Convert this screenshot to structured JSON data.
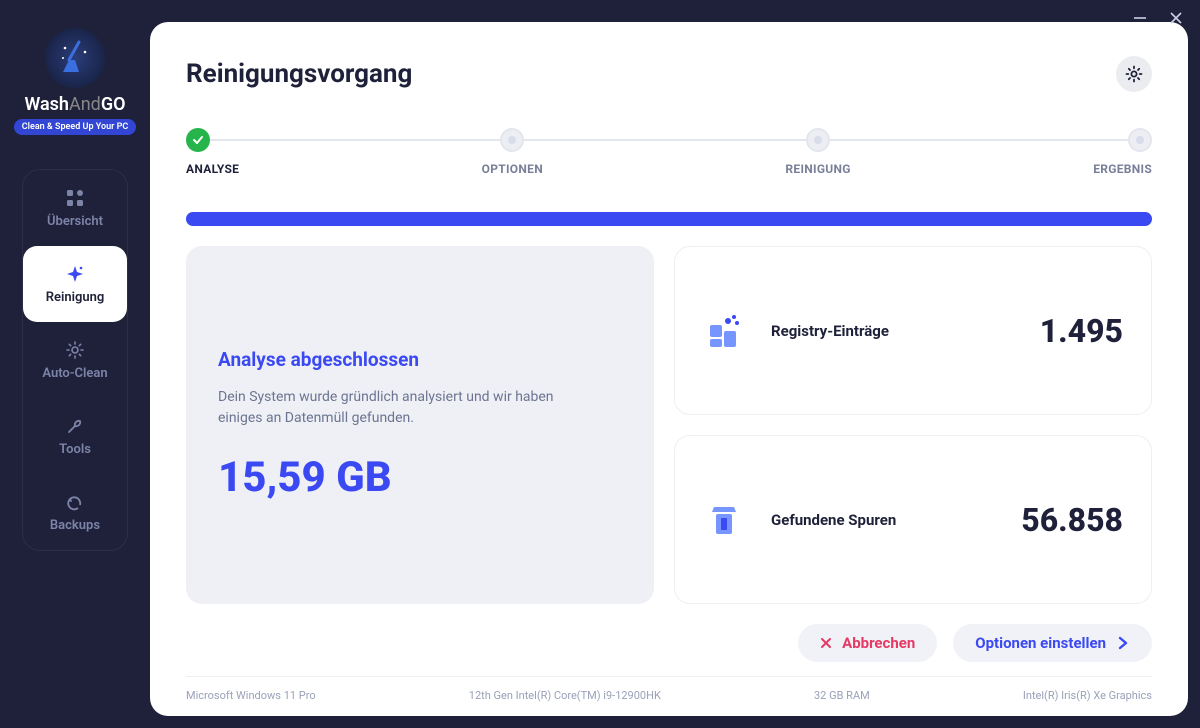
{
  "window": {
    "minimize": "–",
    "close": "✕"
  },
  "brand": {
    "name_a": "Wash",
    "name_b": "And",
    "name_c": "GO",
    "tagline": "Clean & Speed Up Your PC"
  },
  "nav": {
    "overview": "Übersicht",
    "cleaning": "Reinigung",
    "autoclean": "Auto-Clean",
    "tools": "Tools",
    "backups": "Backups"
  },
  "page": {
    "title": "Reinigungsvorgang"
  },
  "steps": {
    "analyse": "ANALYSE",
    "options": "OPTIONEN",
    "cleaning": "REINIGUNG",
    "result": "ERGEBNIS"
  },
  "analysis": {
    "headline": "Analyse abgeschlossen",
    "description": "Dein System wurde gründlich analysiert und wir haben einiges an Datenmüll gefunden.",
    "size": "15,59 GB"
  },
  "stats": {
    "registry_label": "Registry-Einträge",
    "registry_value": "1.495",
    "traces_label": "Gefundene Spuren",
    "traces_value": "56.858"
  },
  "actions": {
    "cancel": "Abbrechen",
    "next": "Optionen einstellen"
  },
  "footer": {
    "os": "Microsoft Windows 11 Pro",
    "cpu": "12th Gen Intel(R) Core(TM) i9-12900HK",
    "ram": "32 GB RAM",
    "gpu": "Intel(R) Iris(R) Xe Graphics"
  }
}
